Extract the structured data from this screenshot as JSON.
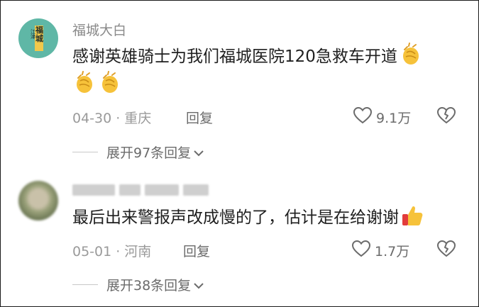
{
  "comments": [
    {
      "user": "福城大白",
      "avatar_text_small": "江津",
      "avatar_text_big": "福城",
      "text": "感谢英雄骑士为我们福城医院120急救车开道",
      "date": "04-30",
      "location": "重庆",
      "reply_label": "回复",
      "likes": "9.1万",
      "expand_label": "展开97条回复",
      "emojis": [
        "clapping-hands",
        "clapping-hands",
        "clapping-hands"
      ]
    },
    {
      "user": "",
      "text": "最后出来警报声改成慢的了，估计是在给谢谢",
      "date": "05-01",
      "location": "河南",
      "reply_label": "回复",
      "likes": "1.7万",
      "expand_label": "展开38条回复",
      "emojis": [
        "thumbs-up"
      ]
    }
  ],
  "separator": "·"
}
